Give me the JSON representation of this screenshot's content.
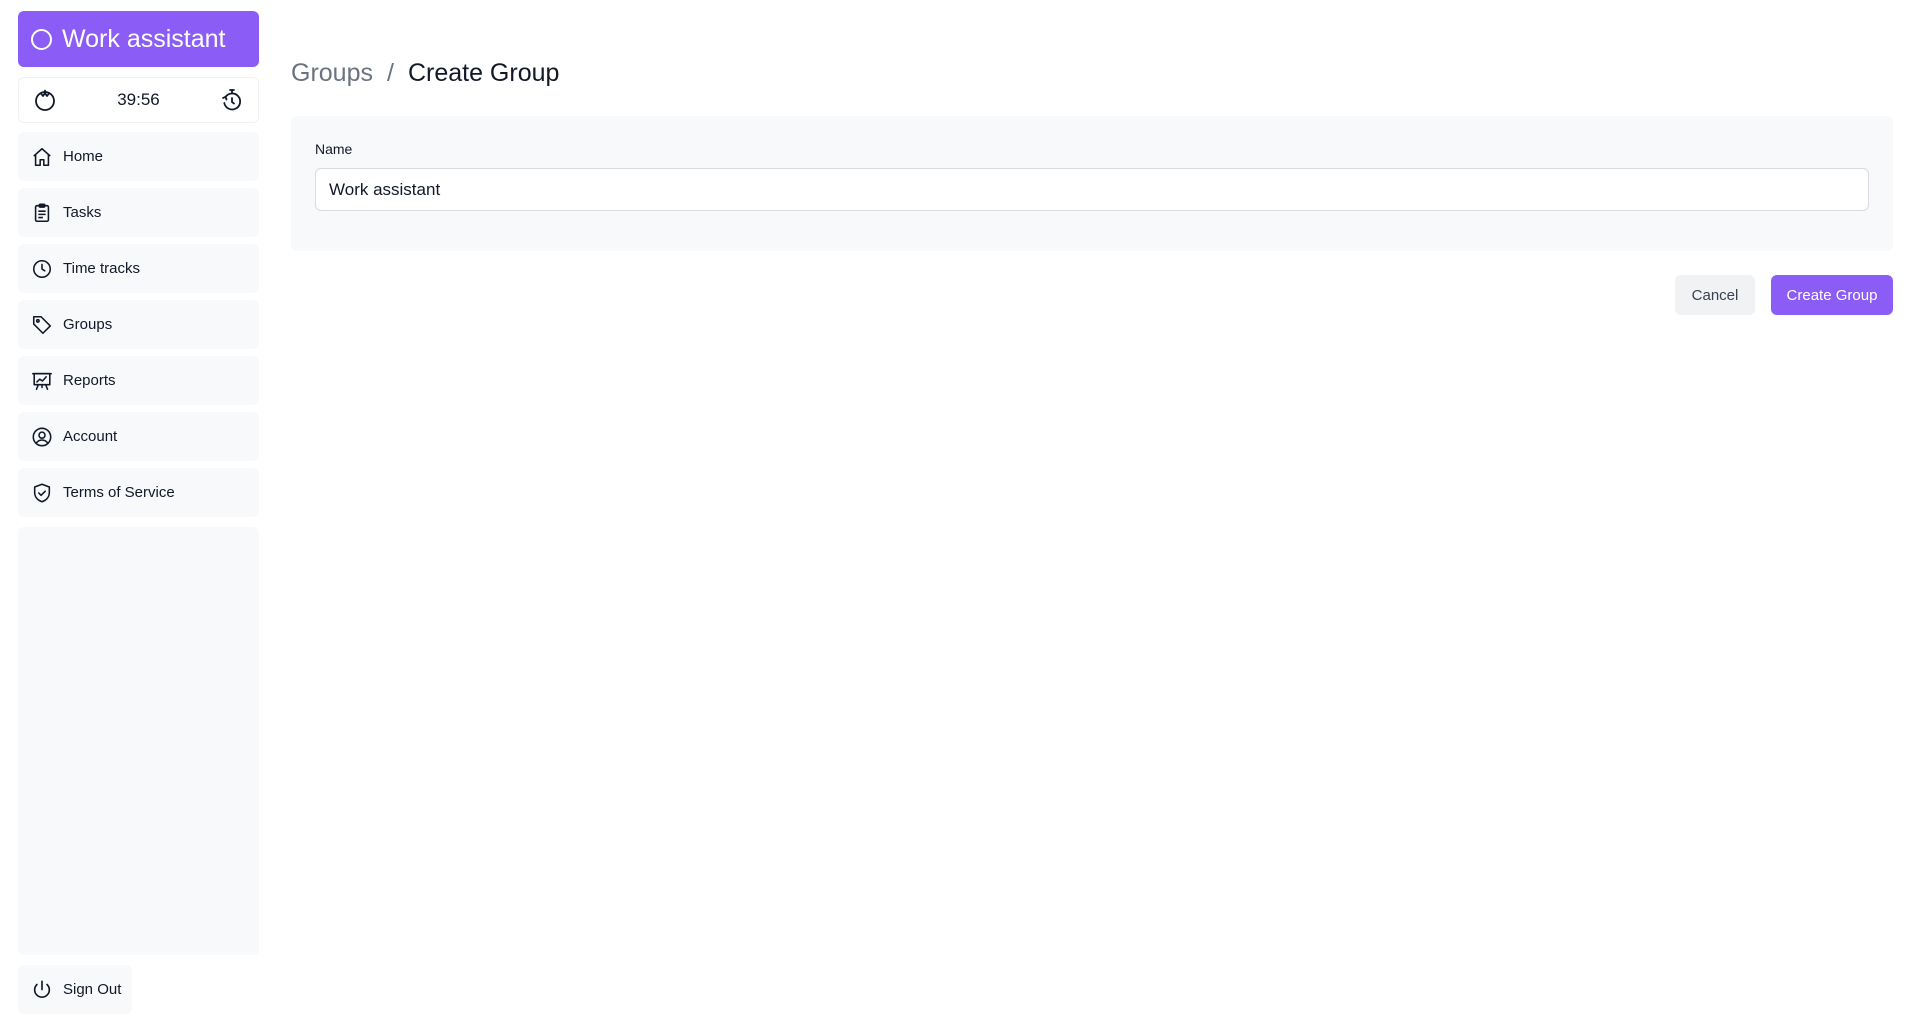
{
  "app": {
    "title": "Work assistant"
  },
  "timer": {
    "value": "39:56"
  },
  "sidebar": {
    "items": [
      {
        "label": "Home",
        "icon": "home-icon"
      },
      {
        "label": "Tasks",
        "icon": "clipboard-icon"
      },
      {
        "label": "Time tracks",
        "icon": "clock-icon"
      },
      {
        "label": "Groups",
        "icon": "tag-icon"
      },
      {
        "label": "Reports",
        "icon": "chart-board-icon"
      },
      {
        "label": "Account",
        "icon": "user-circle-icon"
      },
      {
        "label": "Terms of Service",
        "icon": "shield-check-icon"
      }
    ],
    "signout": "Sign Out"
  },
  "breadcrumb": {
    "parent": "Groups",
    "separator": "/",
    "current": "Create Group"
  },
  "form": {
    "name_label": "Name",
    "name_value": "Work assistant"
  },
  "actions": {
    "cancel": "Cancel",
    "create": "Create Group"
  },
  "colors": {
    "accent": "#8b5cf6",
    "panel": "#f8f9fb"
  }
}
